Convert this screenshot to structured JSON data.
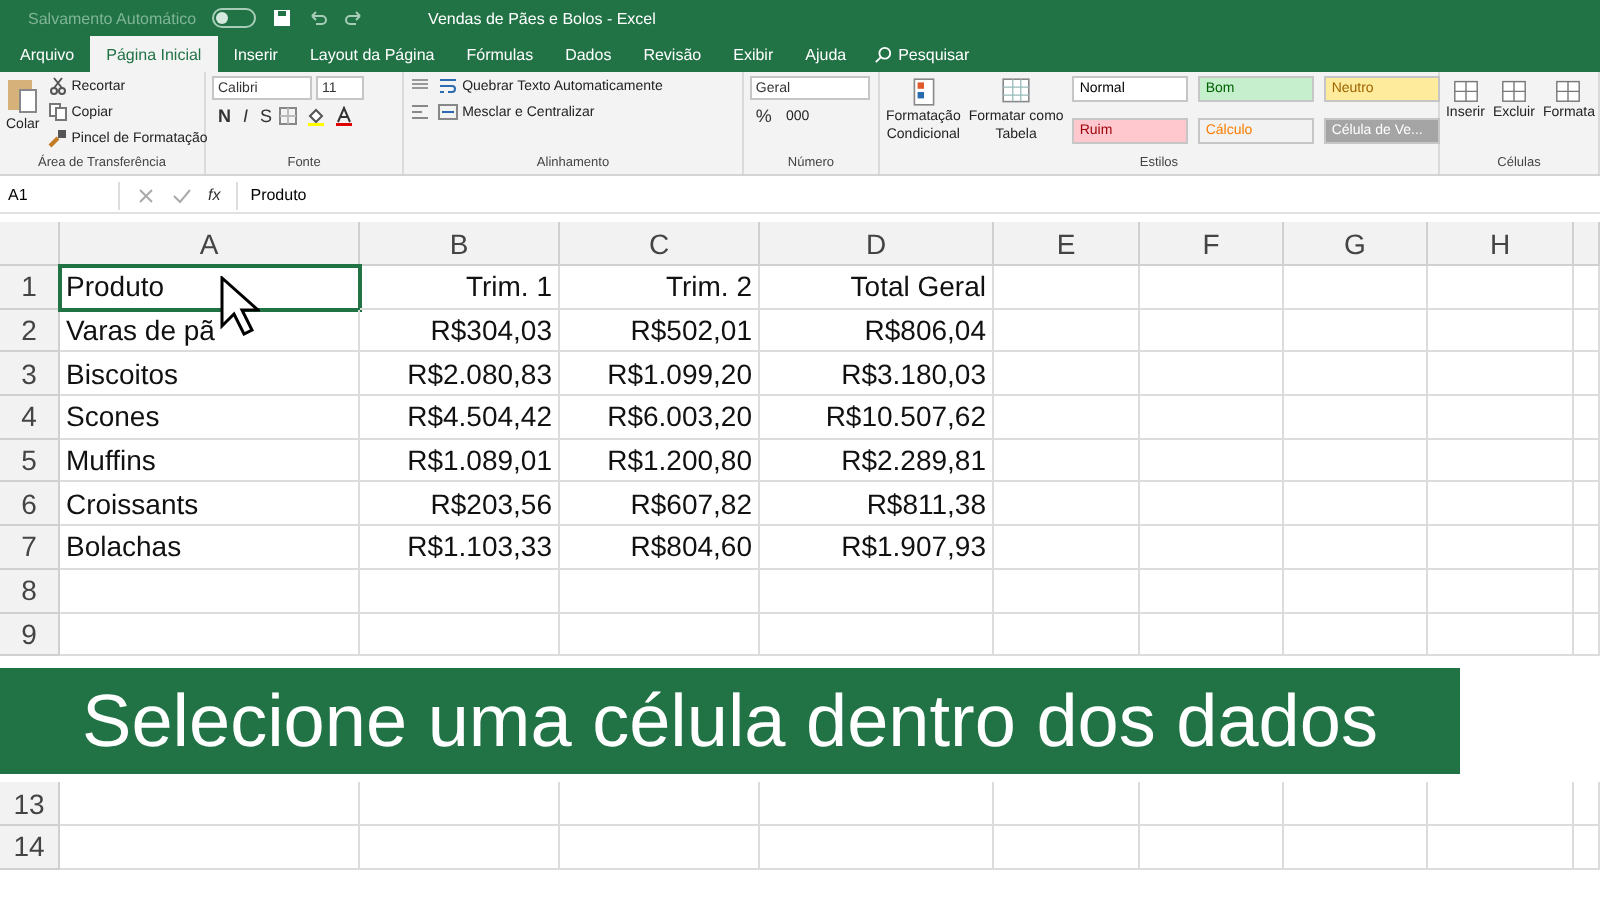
{
  "title_bar": {
    "autosave": {
      "label": "Salvamento Automático",
      "on": false
    },
    "title": "Vendas de Pães e Bolos  -  Excel"
  },
  "tabs": [
    {
      "label": "Arquivo",
      "selected": false
    },
    {
      "label": "Página Inicial",
      "selected": true
    },
    {
      "label": "Inserir",
      "selected": false
    },
    {
      "label": "Layout da Página",
      "selected": false
    },
    {
      "label": "Fórmulas",
      "selected": false
    },
    {
      "label": "Dados",
      "selected": false
    },
    {
      "label": "Revisão",
      "selected": false
    },
    {
      "label": "Exibir",
      "selected": false
    },
    {
      "label": "Ajuda",
      "selected": false
    }
  ],
  "search": {
    "placeholder": "Pesquisar"
  },
  "ribbon": {
    "clipboard": {
      "paste": "Colar",
      "cut": "Recortar",
      "copy": "Copiar",
      "painter": "Pincel de Formatação",
      "label": "Área de Transferência"
    },
    "font": {
      "name": "Calibri",
      "size": "11",
      "bold": "N",
      "italic": "I",
      "underline": "S",
      "label": "Fonte"
    },
    "alignment": {
      "wrap": "Quebrar Texto Automaticamente",
      "merge": "Mesclar e Centralizar",
      "label": "Alinhamento"
    },
    "number": {
      "format": "Geral",
      "percent": "%",
      "thousands": "000",
      "label": "Número"
    },
    "styles": {
      "conditional": [
        "Formatação",
        "Condicional"
      ],
      "table": [
        "Formatar como",
        "Tabela"
      ],
      "label": "Estilos",
      "cell_styles": [
        {
          "text": "Normal",
          "color": "#ffffff"
        },
        {
          "text": "Bom",
          "color": "#c6efce"
        },
        {
          "text": "Neutro",
          "color": "#ffeb9c"
        },
        {
          "text": "Ruim",
          "color": "#ffc7ce"
        },
        {
          "text": "Cálculo",
          "color": "#f2f2f2"
        },
        {
          "text": "Célula de Ve...",
          "color": "#a5a5a5"
        }
      ]
    },
    "cells": {
      "buttons": [
        "Inserir",
        "Excluir",
        "Formata"
      ],
      "label": "Células"
    }
  },
  "formula_bar": {
    "name_box": "A1",
    "fx": "fx",
    "value": "Produto"
  },
  "columns": [
    "A",
    "B",
    "C",
    "D",
    "E",
    "F",
    "G",
    "H"
  ],
  "rows": [
    {
      "number": "1",
      "cells": [
        {
          "text": "Produto",
          "selected": true
        },
        {
          "text": "Trim. 1",
          "selected": false
        },
        {
          "text": "Trim. 2",
          "selected": false
        },
        {
          "text": "Total Geral",
          "selected": false
        }
      ]
    },
    {
      "number": "2",
      "cells": [
        {
          "text": "Varas de pã",
          "selected": false
        },
        {
          "text": "R$304,03",
          "selected": false
        },
        {
          "text": "R$502,01",
          "selected": false
        },
        {
          "text": "R$806,04",
          "selected": false
        }
      ]
    },
    {
      "number": "3",
      "cells": [
        {
          "text": "Biscoitos",
          "selected": false
        },
        {
          "text": "R$2.080,83",
          "selected": false
        },
        {
          "text": "R$1.099,20",
          "selected": false
        },
        {
          "text": "R$3.180,03",
          "selected": false
        }
      ]
    },
    {
      "number": "4",
      "cells": [
        {
          "text": "Scones",
          "selected": false
        },
        {
          "text": "R$4.504,42",
          "selected": false
        },
        {
          "text": "R$6.003,20",
          "selected": false
        },
        {
          "text": "R$10.507,62",
          "selected": false
        }
      ]
    },
    {
      "number": "5",
      "cells": [
        {
          "text": "Muffins",
          "selected": false
        },
        {
          "text": "R$1.089,01",
          "selected": false
        },
        {
          "text": "R$1.200,80",
          "selected": false
        },
        {
          "text": "R$2.289,81",
          "selected": false
        }
      ]
    },
    {
      "number": "6",
      "cells": [
        {
          "text": "Croissants",
          "selected": false
        },
        {
          "text": "R$203,56",
          "selected": false
        },
        {
          "text": "R$607,82",
          "selected": false
        },
        {
          "text": "R$811,38",
          "selected": false
        }
      ]
    },
    {
      "number": "7",
      "cells": [
        {
          "text": "Bolachas",
          "selected": false
        },
        {
          "text": "R$1.103,33",
          "selected": false
        },
        {
          "text": "R$804,60",
          "selected": false
        },
        {
          "text": "R$1.907,93",
          "selected": false
        }
      ]
    },
    {
      "number": "8",
      "cells": []
    },
    {
      "number": "9",
      "cells": []
    }
  ],
  "caption": "Selecione uma célula dentro dos dados",
  "rows_below": [
    {
      "number": "13"
    },
    {
      "number": "14"
    }
  ]
}
